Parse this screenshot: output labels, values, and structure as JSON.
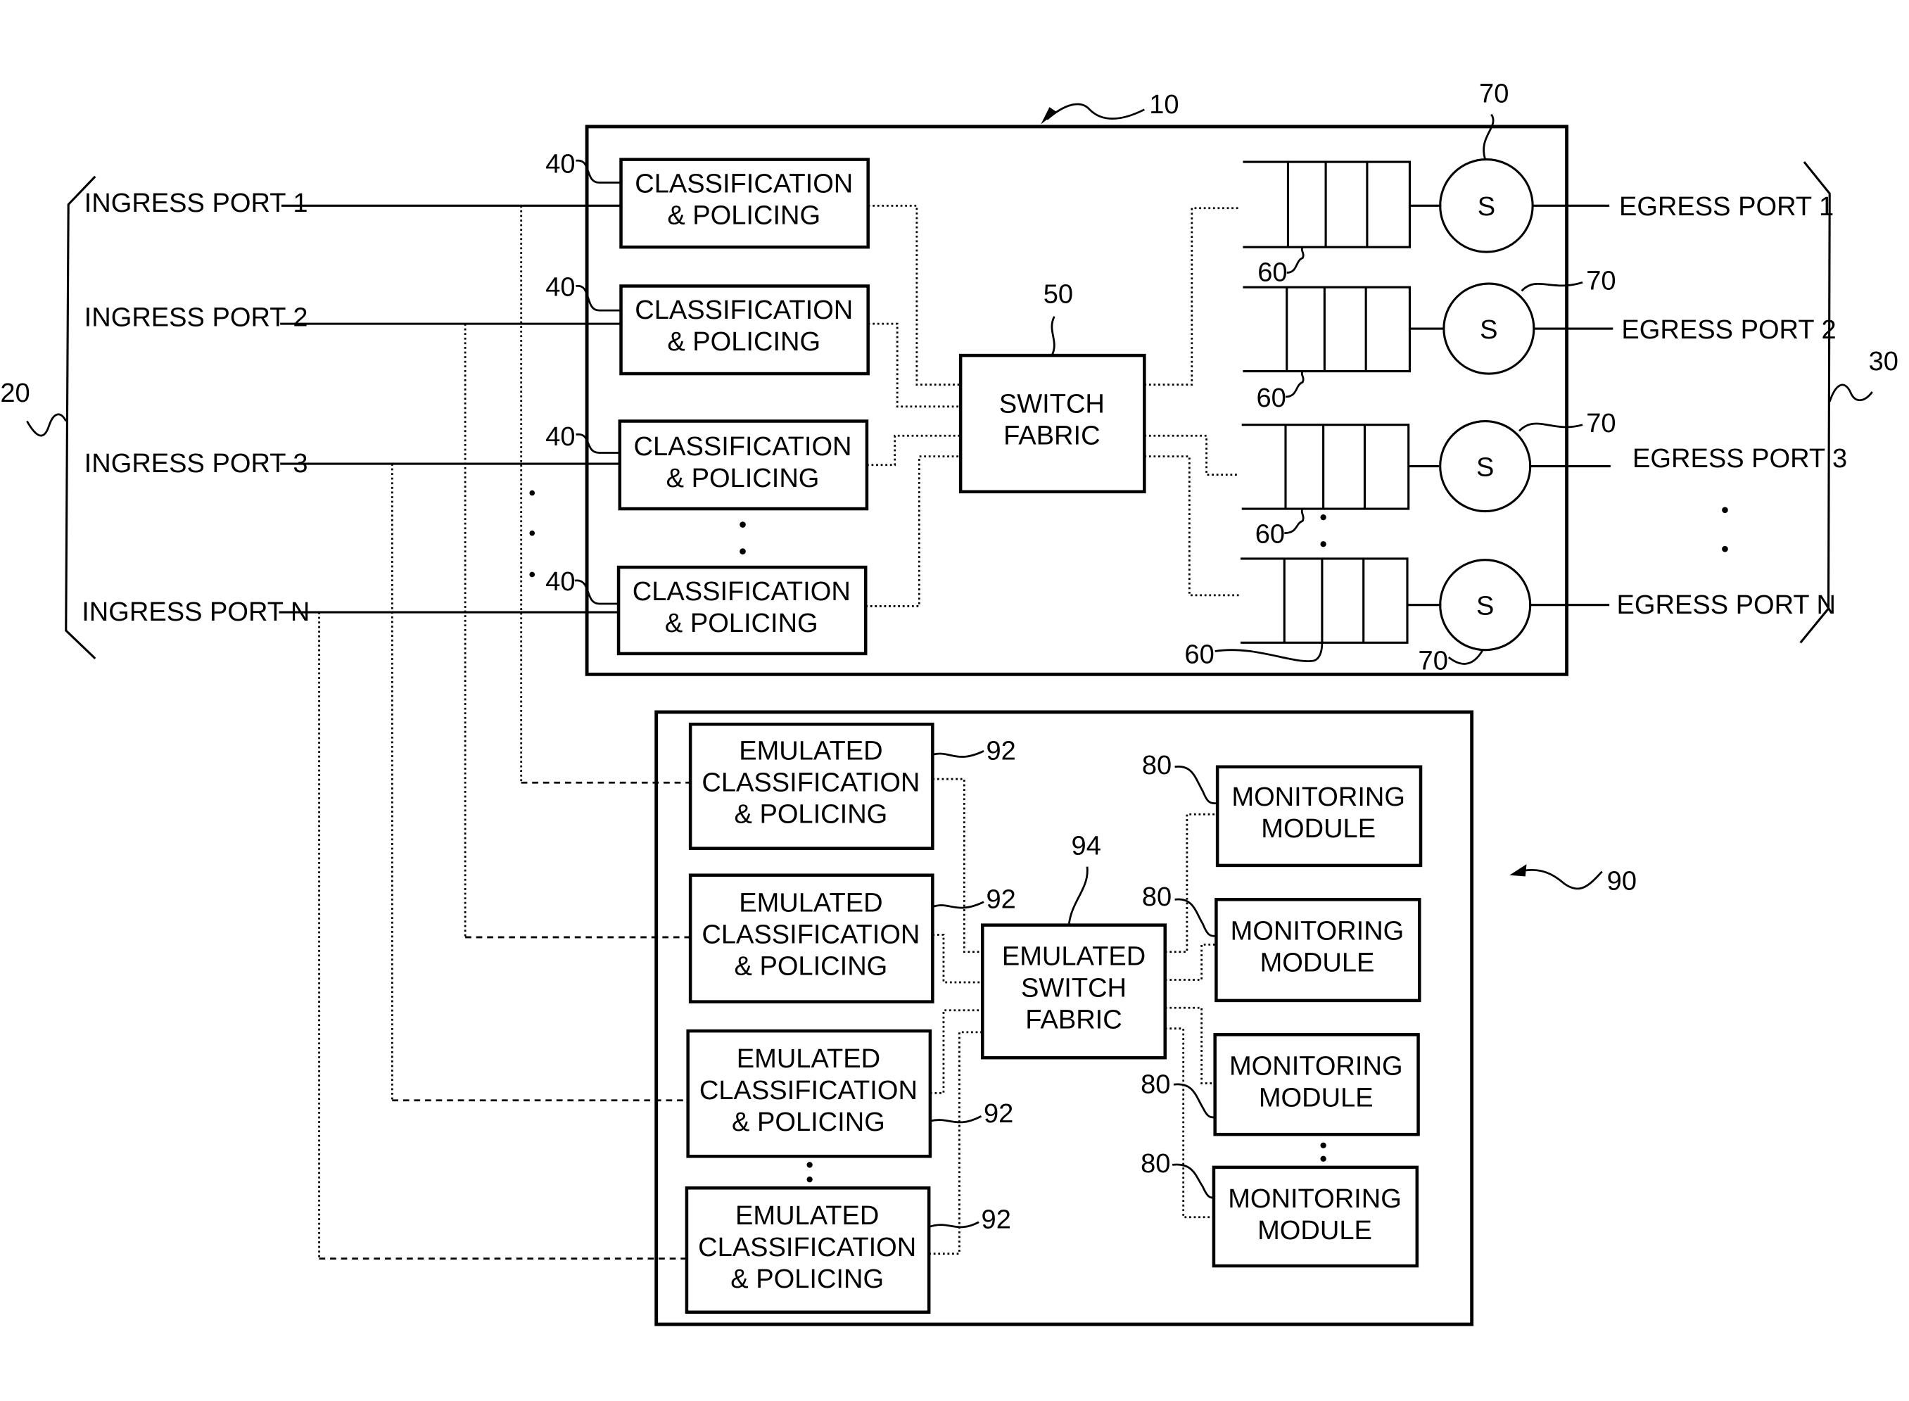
{
  "figure": {
    "system_ref": "10",
    "emulator_ref": "90",
    "ingress_group_ref": "20",
    "egress_group_ref": "30"
  },
  "ingress_ports": [
    {
      "label": "INGRESS PORT 1"
    },
    {
      "label": "INGRESS PORT 2"
    },
    {
      "label": "INGRESS PORT 3"
    },
    {
      "label": "INGRESS PORT N"
    }
  ],
  "egress_ports": [
    {
      "label": "EGRESS PORT 1"
    },
    {
      "label": "EGRESS PORT 2"
    },
    {
      "label": "EGRESS PORT 3"
    },
    {
      "label": "EGRESS PORT N"
    }
  ],
  "classification_blocks": [
    {
      "line1": "CLASSIFICATION",
      "line2": "& POLICING",
      "ref": "40"
    },
    {
      "line1": "CLASSIFICATION",
      "line2": "& POLICING",
      "ref": "40"
    },
    {
      "line1": "CLASSIFICATION",
      "line2": "& POLICING",
      "ref": "40"
    },
    {
      "line1": "CLASSIFICATION",
      "line2": "& POLICING",
      "ref": "40"
    }
  ],
  "switch_fabric": {
    "line1": "SWITCH",
    "line2": "FABRIC",
    "ref": "50"
  },
  "queues": [
    {
      "ref": "60"
    },
    {
      "ref": "60"
    },
    {
      "ref": "60"
    },
    {
      "ref": "60"
    }
  ],
  "schedulers": [
    {
      "symbol": "S",
      "ref": "70"
    },
    {
      "symbol": "S",
      "ref": "70"
    },
    {
      "symbol": "S",
      "ref": "70"
    },
    {
      "symbol": "S",
      "ref": "70"
    }
  ],
  "emulated_blocks": [
    {
      "line1": "EMULATED",
      "line2": "CLASSIFICATION",
      "line3": "& POLICING",
      "ref": "92"
    },
    {
      "line1": "EMULATED",
      "line2": "CLASSIFICATION",
      "line3": "& POLICING",
      "ref": "92"
    },
    {
      "line1": "EMULATED",
      "line2": "CLASSIFICATION",
      "line3": "& POLICING",
      "ref": "92"
    },
    {
      "line1": "EMULATED",
      "line2": "CLASSIFICATION",
      "line3": "& POLICING",
      "ref": "92"
    }
  ],
  "emulated_switch_fabric": {
    "line1": "EMULATED",
    "line2": "SWITCH",
    "line3": "FABRIC",
    "ref": "94"
  },
  "monitoring_modules": [
    {
      "line1": "MONITORING",
      "line2": "MODULE",
      "ref": "80"
    },
    {
      "line1": "MONITORING",
      "line2": "MODULE",
      "ref": "80"
    },
    {
      "line1": "MONITORING",
      "line2": "MODULE",
      "ref": "80"
    },
    {
      "line1": "MONITORING",
      "line2": "MODULE",
      "ref": "80"
    }
  ]
}
